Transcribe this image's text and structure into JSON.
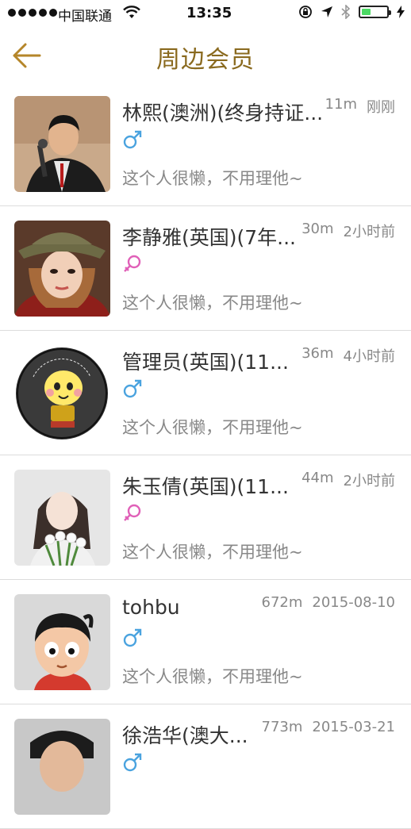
{
  "status_bar": {
    "carrier": "中国联通",
    "time": "13:35"
  },
  "nav": {
    "title": "周边会员",
    "back_icon": "arrow-left-icon",
    "accent_color": "#8a6a1f"
  },
  "members": [
    {
      "name": "林熙(澳洲)(终身持证...",
      "distance": "11m",
      "time": "刚刚",
      "gender": "male",
      "signature": "这个人很懒，不用理他~"
    },
    {
      "name": "李静雅(英国)(7年...",
      "distance": "30m",
      "time": "2小时前",
      "gender": "female",
      "signature": "这个人很懒，不用理他~"
    },
    {
      "name": "管理员(英国)(11...",
      "distance": "36m",
      "time": "4小时前",
      "gender": "male",
      "signature": "这个人很懒，不用理他~"
    },
    {
      "name": "朱玉倩(英国)(11...",
      "distance": "44m",
      "time": "2小时前",
      "gender": "female",
      "signature": "这个人很懒，不用理他~"
    },
    {
      "name": "tohbu",
      "distance": "672m",
      "time": "2015-08-10",
      "gender": "male",
      "signature": "这个人很懒，不用理他~"
    },
    {
      "name": "徐浩华(澳大...",
      "distance": "773m",
      "time": "2015-03-21",
      "gender": "male",
      "signature": ""
    }
  ],
  "colors": {
    "male": "#4aa3df",
    "female": "#e060b8"
  }
}
